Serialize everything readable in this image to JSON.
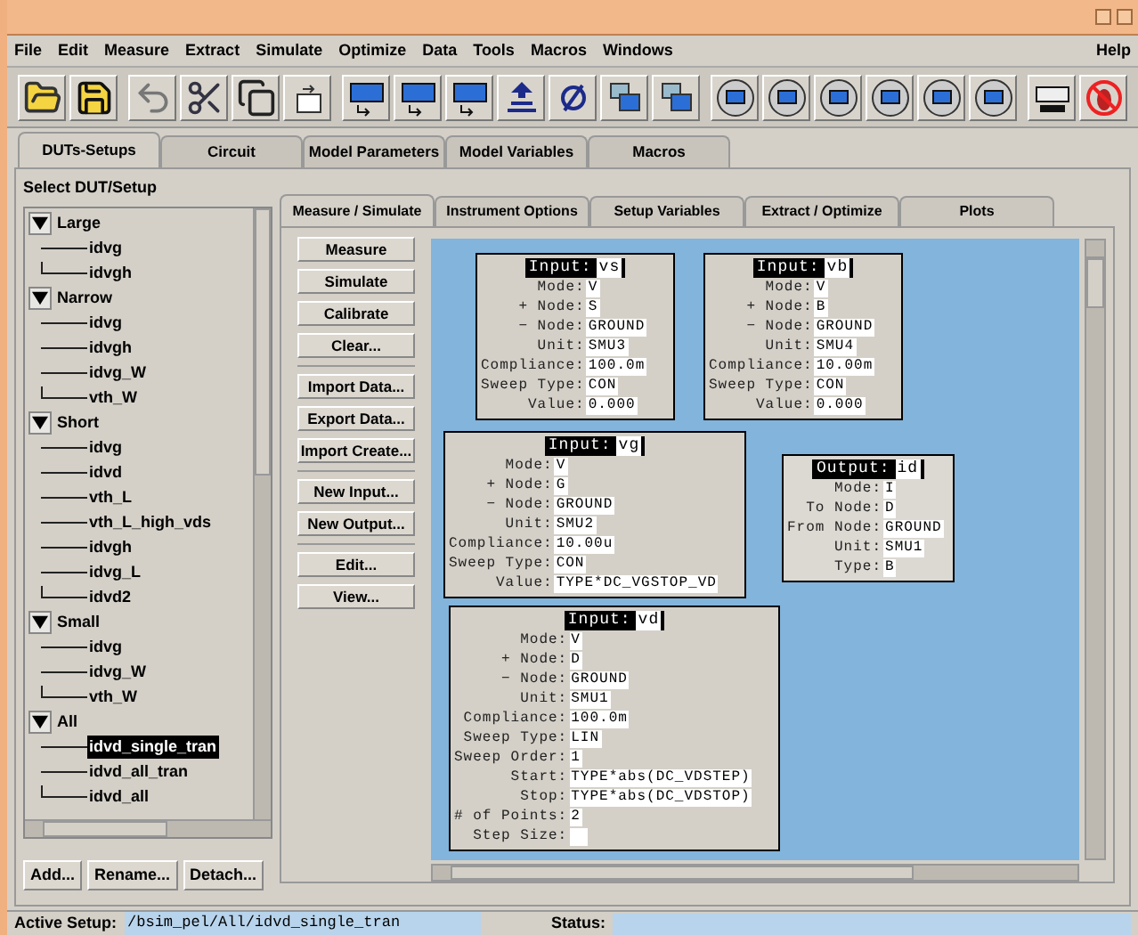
{
  "menu": [
    {
      "label": "File"
    },
    {
      "label": "Edit"
    },
    {
      "label": "Measure"
    },
    {
      "label": "Extract"
    },
    {
      "label": "Simulate"
    },
    {
      "label": "Optimize"
    },
    {
      "label": "Data"
    },
    {
      "label": "Tools"
    },
    {
      "label": "Macros"
    },
    {
      "label": "Windows"
    }
  ],
  "help": "Help",
  "tabs": [
    {
      "label": "DUTs-Setups",
      "selected": true
    },
    {
      "label": "Circuit",
      "selected": false
    },
    {
      "label": "Model Parameters",
      "selected": false
    },
    {
      "label": "Model Variables",
      "selected": false
    },
    {
      "label": "Macros",
      "selected": false
    }
  ],
  "panel_title": "Select DUT/Setup",
  "tree": [
    {
      "label": "Large",
      "expanded": true,
      "children": [
        {
          "label": "idvg",
          "selected": false
        },
        {
          "label": "idvgh",
          "selected": false
        }
      ]
    },
    {
      "label": "Narrow",
      "expanded": true,
      "children": [
        {
          "label": "idvg",
          "selected": false
        },
        {
          "label": "idvgh",
          "selected": false
        },
        {
          "label": "idvg_W",
          "selected": false
        },
        {
          "label": "vth_W",
          "selected": false
        }
      ]
    },
    {
      "label": "Short",
      "expanded": true,
      "children": [
        {
          "label": "idvg",
          "selected": false
        },
        {
          "label": "idvd",
          "selected": false
        },
        {
          "label": "vth_L",
          "selected": false
        },
        {
          "label": "vth_L_high_vds",
          "selected": false
        },
        {
          "label": "idvgh",
          "selected": false
        },
        {
          "label": "idvg_L",
          "selected": false
        },
        {
          "label": "idvd2",
          "selected": false
        }
      ]
    },
    {
      "label": "Small",
      "expanded": true,
      "children": [
        {
          "label": "idvg",
          "selected": false
        },
        {
          "label": "idvg_W",
          "selected": false
        },
        {
          "label": "vth_W",
          "selected": false
        }
      ]
    },
    {
      "label": "All",
      "expanded": true,
      "children": [
        {
          "label": "idvd_single_tran",
          "selected": true
        },
        {
          "label": "idvd_all_tran",
          "selected": false
        },
        {
          "label": "idvd_all",
          "selected": false
        }
      ]
    }
  ],
  "tree_buttons": [
    "Add...",
    "Rename...",
    "Detach..."
  ],
  "subtabs": [
    {
      "label": "Measure / Simulate",
      "selected": true
    },
    {
      "label": "Instrument Options",
      "selected": false
    },
    {
      "label": "Setup Variables",
      "selected": false
    },
    {
      "label": "Extract / Optimize",
      "selected": false
    },
    {
      "label": "Plots",
      "selected": false
    }
  ],
  "action_groups": [
    [
      "Measure",
      "Simulate",
      "Calibrate",
      "Clear..."
    ],
    [
      "Import Data...",
      "Export Data...",
      "Import Create..."
    ],
    [
      "New Input...",
      "New Output..."
    ],
    [
      "Edit...",
      "View..."
    ]
  ],
  "blocks": [
    {
      "kind": "input",
      "heading": "Input:",
      "name": "vs",
      "fields": [
        {
          "label": "Mode:",
          "value": "V"
        },
        {
          "label": "+ Node:",
          "value": "S"
        },
        {
          "label": "− Node:",
          "value": "GROUND"
        },
        {
          "label": "Unit:",
          "value": "SMU3"
        },
        {
          "label": "Compliance:",
          "value": "100.0m"
        },
        {
          "label": "Sweep Type:",
          "value": "CON"
        },
        {
          "label": "Value:",
          "value": "0.000"
        }
      ]
    },
    {
      "kind": "input",
      "heading": "Input:",
      "name": "vb",
      "fields": [
        {
          "label": "Mode:",
          "value": "V"
        },
        {
          "label": "+ Node:",
          "value": "B"
        },
        {
          "label": "− Node:",
          "value": "GROUND"
        },
        {
          "label": "Unit:",
          "value": "SMU4"
        },
        {
          "label": "Compliance:",
          "value": "10.00m"
        },
        {
          "label": "Sweep Type:",
          "value": "CON"
        },
        {
          "label": "Value:",
          "value": "0.000"
        }
      ]
    },
    {
      "kind": "input",
      "heading": "Input:",
      "name": "vg",
      "fields": [
        {
          "label": "Mode:",
          "value": "V"
        },
        {
          "label": "+ Node:",
          "value": "G"
        },
        {
          "label": "− Node:",
          "value": "GROUND"
        },
        {
          "label": "Unit:",
          "value": "SMU2"
        },
        {
          "label": "Compliance:",
          "value": "10.00u"
        },
        {
          "label": "Sweep Type:",
          "value": "CON"
        },
        {
          "label": "Value:",
          "value": "TYPE*DC_VGSTOP_VD"
        }
      ]
    },
    {
      "kind": "output",
      "heading": "Output:",
      "name": "id",
      "fields": [
        {
          "label": "Mode:",
          "value": "I"
        },
        {
          "label": "To Node:",
          "value": "D"
        },
        {
          "label": "From Node:",
          "value": "GROUND"
        },
        {
          "label": "Unit:",
          "value": "SMU1"
        },
        {
          "label": "Type:",
          "value": "B"
        }
      ]
    },
    {
      "kind": "input",
      "heading": "Input:",
      "name": "vd",
      "fields": [
        {
          "label": "Mode:",
          "value": "V"
        },
        {
          "label": "+ Node:",
          "value": "D"
        },
        {
          "label": "− Node:",
          "value": "GROUND"
        },
        {
          "label": "Unit:",
          "value": "SMU1"
        },
        {
          "label": "Compliance:",
          "value": "100.0m"
        },
        {
          "label": "Sweep Type:",
          "value": "LIN"
        },
        {
          "label": "Sweep Order:",
          "value": "1"
        },
        {
          "label": "Start:",
          "value": "TYPE*abs(DC_VDSTEP)"
        },
        {
          "label": "Stop:",
          "value": "TYPE*abs(DC_VDSTOP)"
        },
        {
          "label": "# of Points:",
          "value": "2"
        },
        {
          "label": "Step Size:"
        }
      ]
    }
  ],
  "status": {
    "active_label": "Active Setup:",
    "active_value": "/bsim_pel/All/idvd_single_tran",
    "status_label": "Status:"
  }
}
